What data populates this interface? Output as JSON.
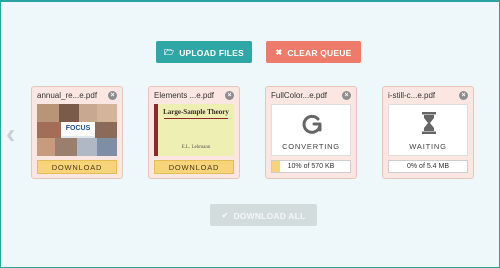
{
  "toolbar": {
    "upload_label": "UPLOAD FILES",
    "upload_icon": "folder-open-icon",
    "clear_label": "CLEAR QUEUE",
    "clear_icon": "x-icon",
    "download_all_label": "DOWNLOAD ALL",
    "download_all_icon": "check-icon"
  },
  "files": [
    {
      "name": "annual_re...e.pdf",
      "state": "done",
      "download_label": "DOWNLOAD",
      "thumb_text": "FOCUS"
    },
    {
      "name": "Elements ...e.pdf",
      "state": "done",
      "download_label": "DOWNLOAD",
      "thumb_title": "Large-Sample Theory",
      "thumb_author": "E.L. Lehmann"
    },
    {
      "name": "FullColor...e.pdf",
      "state": "converting",
      "status_label": "CONVERTING",
      "progress_text": "10% of 570 KB",
      "progress": 0.1
    },
    {
      "name": "i-still-c...e.pdf",
      "state": "waiting",
      "status_label": "WAITING",
      "progress_text": "0% of 5.4 MB",
      "progress": 0.0
    }
  ],
  "colors": {
    "teal": "#2fa7a6",
    "coral": "#ee7a6a",
    "download_yellow": "#f7d37a",
    "card_bg": "#fbe6e1"
  }
}
